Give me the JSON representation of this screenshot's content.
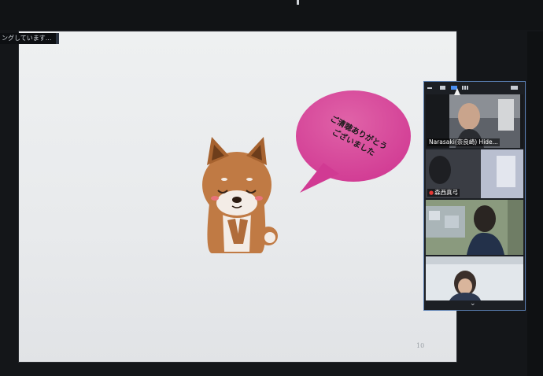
{
  "share": {
    "banner_text": "ングしています..."
  },
  "slide": {
    "page_number": "10",
    "speech_bubble_lines": [
      "ご清聴ありがとう",
      "ございました"
    ],
    "illustration": "bowing-shiba-dog",
    "bubble_color": "#d63f9a"
  },
  "video_panel": {
    "toolbar_icons": [
      "minimize-icon",
      "speaker-view-icon",
      "strip-view-icon",
      "grid-view-icon",
      "exit-fullscreen-icon"
    ],
    "participants": [
      {
        "name": "Narasaki(奈良崎) Hide...",
        "muted": false
      },
      {
        "name": "森西真弓",
        "muted": true
      },
      {
        "name": "",
        "muted": false
      },
      {
        "name": "",
        "muted": false
      }
    ],
    "expand_icon": "chevron-down-icon"
  }
}
